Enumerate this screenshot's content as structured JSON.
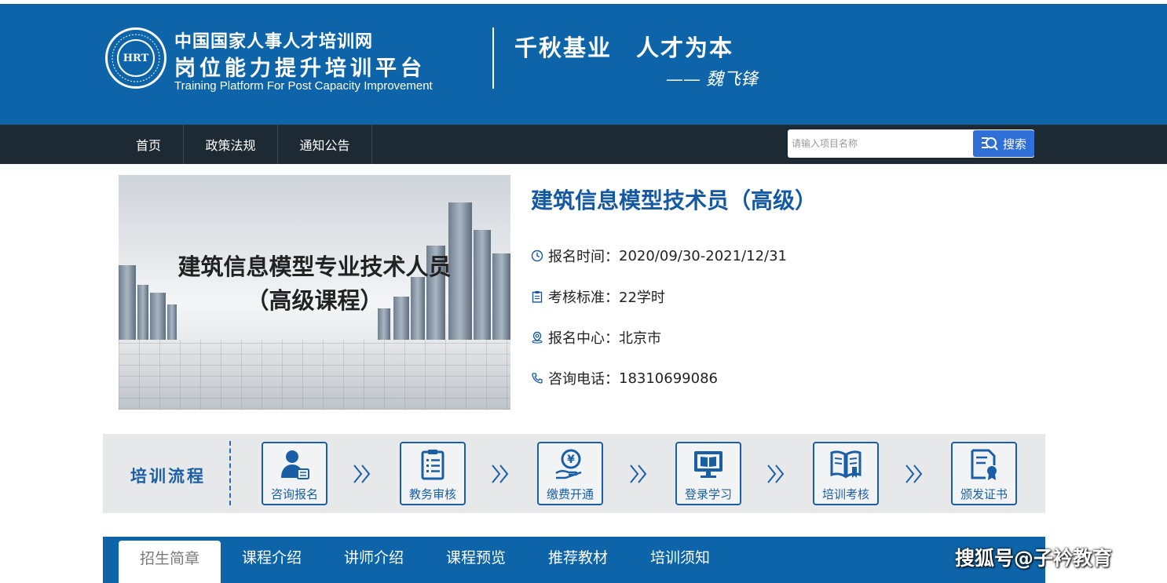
{
  "banner": {
    "logo_text": "HRT",
    "org_name": "中国国家人事人才培训网",
    "platform_name": "岗位能力提升培训平台",
    "platform_en": "Training Platform For Post Capacity Improvement",
    "slogan": "千秋基业　人才为本",
    "signature": "—— 魏飞锋",
    "color": "#0e64a8"
  },
  "nav": {
    "items": [
      {
        "label": "首页"
      },
      {
        "label": "政策法规"
      },
      {
        "label": "通知公告"
      }
    ],
    "search": {
      "placeholder": "请输入项目名称",
      "value": "",
      "button_label": "搜索",
      "button_icon": "search-icon"
    }
  },
  "course": {
    "image_line1": "建筑信息模型专业技术人员",
    "image_line2": "（高级课程）",
    "title": "建筑信息模型技术员（高级）",
    "info": [
      {
        "icon": "clock-icon",
        "label": "报名时间：",
        "value": "2020/09/30-2021/12/31"
      },
      {
        "icon": "clipboard-icon",
        "label": "考核标准：",
        "value": "22学时"
      },
      {
        "icon": "location-icon",
        "label": "报名中心：",
        "value": "北京市"
      },
      {
        "icon": "phone-icon",
        "label": "咨询电话：",
        "value": "18310699086"
      }
    ]
  },
  "process": {
    "label": "培训流程",
    "steps": [
      {
        "label": "咨询报名",
        "icon": "user-id-icon"
      },
      {
        "label": "教务审核",
        "icon": "clipboard-list-icon"
      },
      {
        "label": "缴费开通",
        "icon": "yuan-hand-icon"
      },
      {
        "label": "登录学习",
        "icon": "monitor-book-icon"
      },
      {
        "label": "培训考核",
        "icon": "open-book-icon"
      },
      {
        "label": "颁发证书",
        "icon": "certificate-icon"
      }
    ],
    "accent": "#1a5fa6"
  },
  "tabs": [
    {
      "label": "招生简章",
      "active": true
    },
    {
      "label": "课程介绍",
      "active": false
    },
    {
      "label": "讲师介绍",
      "active": false
    },
    {
      "label": "课程预览",
      "active": false
    },
    {
      "label": "推荐教材",
      "active": false
    },
    {
      "label": "培训须知",
      "active": false
    }
  ],
  "watermark": "搜狐号@子衿教育"
}
